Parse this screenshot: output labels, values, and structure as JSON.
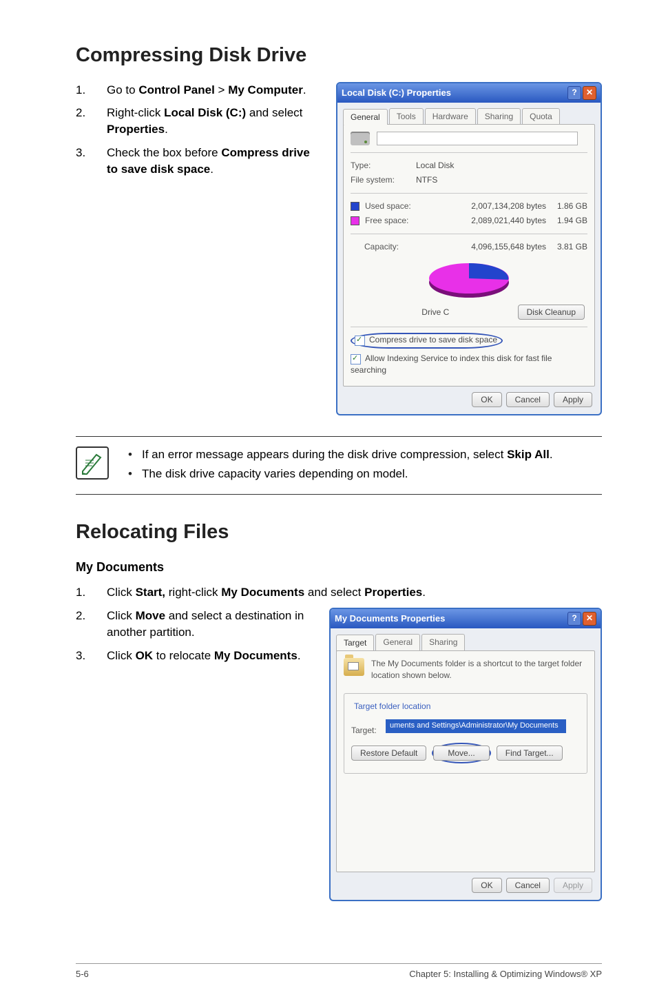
{
  "h1_1": "Compressing Disk Drive",
  "steps1": {
    "s1a": "Go to ",
    "s1b": "Control Panel",
    "s1c": " > ",
    "s1d": "My Computer",
    "s1e": ".",
    "s2a": "Right-click ",
    "s2b": "Local Disk (C:)",
    "s2c": " and select ",
    "s2d": "Properties",
    "s2e": ".",
    "s3a": "Check the box before ",
    "s3b": "Compress drive to save disk space",
    "s3c": "."
  },
  "dlg1": {
    "title": "Local Disk (C:) Properties",
    "help": "?",
    "close": "✕",
    "tabs": {
      "t0": "General",
      "t1": "Tools",
      "t2": "Hardware",
      "t3": "Sharing",
      "t4": "Quota"
    },
    "type_k": "Type:",
    "type_v": "Local Disk",
    "fs_k": "File system:",
    "fs_v": "NTFS",
    "used_k": "Used space:",
    "used_v": "2,007,134,208 bytes",
    "used_g": "1.86 GB",
    "free_k": "Free space:",
    "free_v": "2,089,021,440 bytes",
    "free_g": "1.94 GB",
    "cap_k": "Capacity:",
    "cap_v": "4,096,155,648 bytes",
    "cap_g": "3.81 GB",
    "drive_label": "Drive C",
    "cleanup_btn": "Disk Cleanup",
    "chk1": "Compress drive to save disk space",
    "chk2": "Allow Indexing Service to index this disk for fast file searching",
    "ok": "OK",
    "cancel": "Cancel",
    "apply": "Apply"
  },
  "note": {
    "n1a": "If an error message appears during the disk drive compression, select ",
    "n1b": "Skip All",
    "n1c": ".",
    "n2": "The disk drive capacity varies depending on model."
  },
  "h1_2": "Relocating Files",
  "sub1": "My Documents",
  "steps2": {
    "s1a": "Click ",
    "s1b": "Start,",
    "s1c": " right-click ",
    "s1d": "My Documents",
    "s1e": " and select ",
    "s1f": "Properties",
    "s1g": ".",
    "s2a": "Click ",
    "s2b": "Move",
    "s2c": " and select a destination in another partition.",
    "s3a": "Click ",
    "s3b": "OK",
    "s3c": " to relocate ",
    "s3d": "My Documents",
    "s3e": "."
  },
  "dlg2": {
    "title": "My Documents Properties",
    "help": "?",
    "close": "✕",
    "tabs": {
      "t0": "Target",
      "t1": "General",
      "t2": "Sharing"
    },
    "desc": "The My Documents folder is a shortcut to the target folder location shown below.",
    "legend": "Target folder location",
    "target_k": "Target:",
    "target_v": "uments and Settings\\Administrator\\My Documents",
    "btn_restore": "Restore Default",
    "btn_move": "Move...",
    "btn_find": "Find Target...",
    "ok": "OK",
    "cancel": "Cancel",
    "apply": "Apply"
  },
  "footer": {
    "page": "5-6",
    "chapter": "Chapter 5: Installing & Optimizing Windows® XP"
  }
}
